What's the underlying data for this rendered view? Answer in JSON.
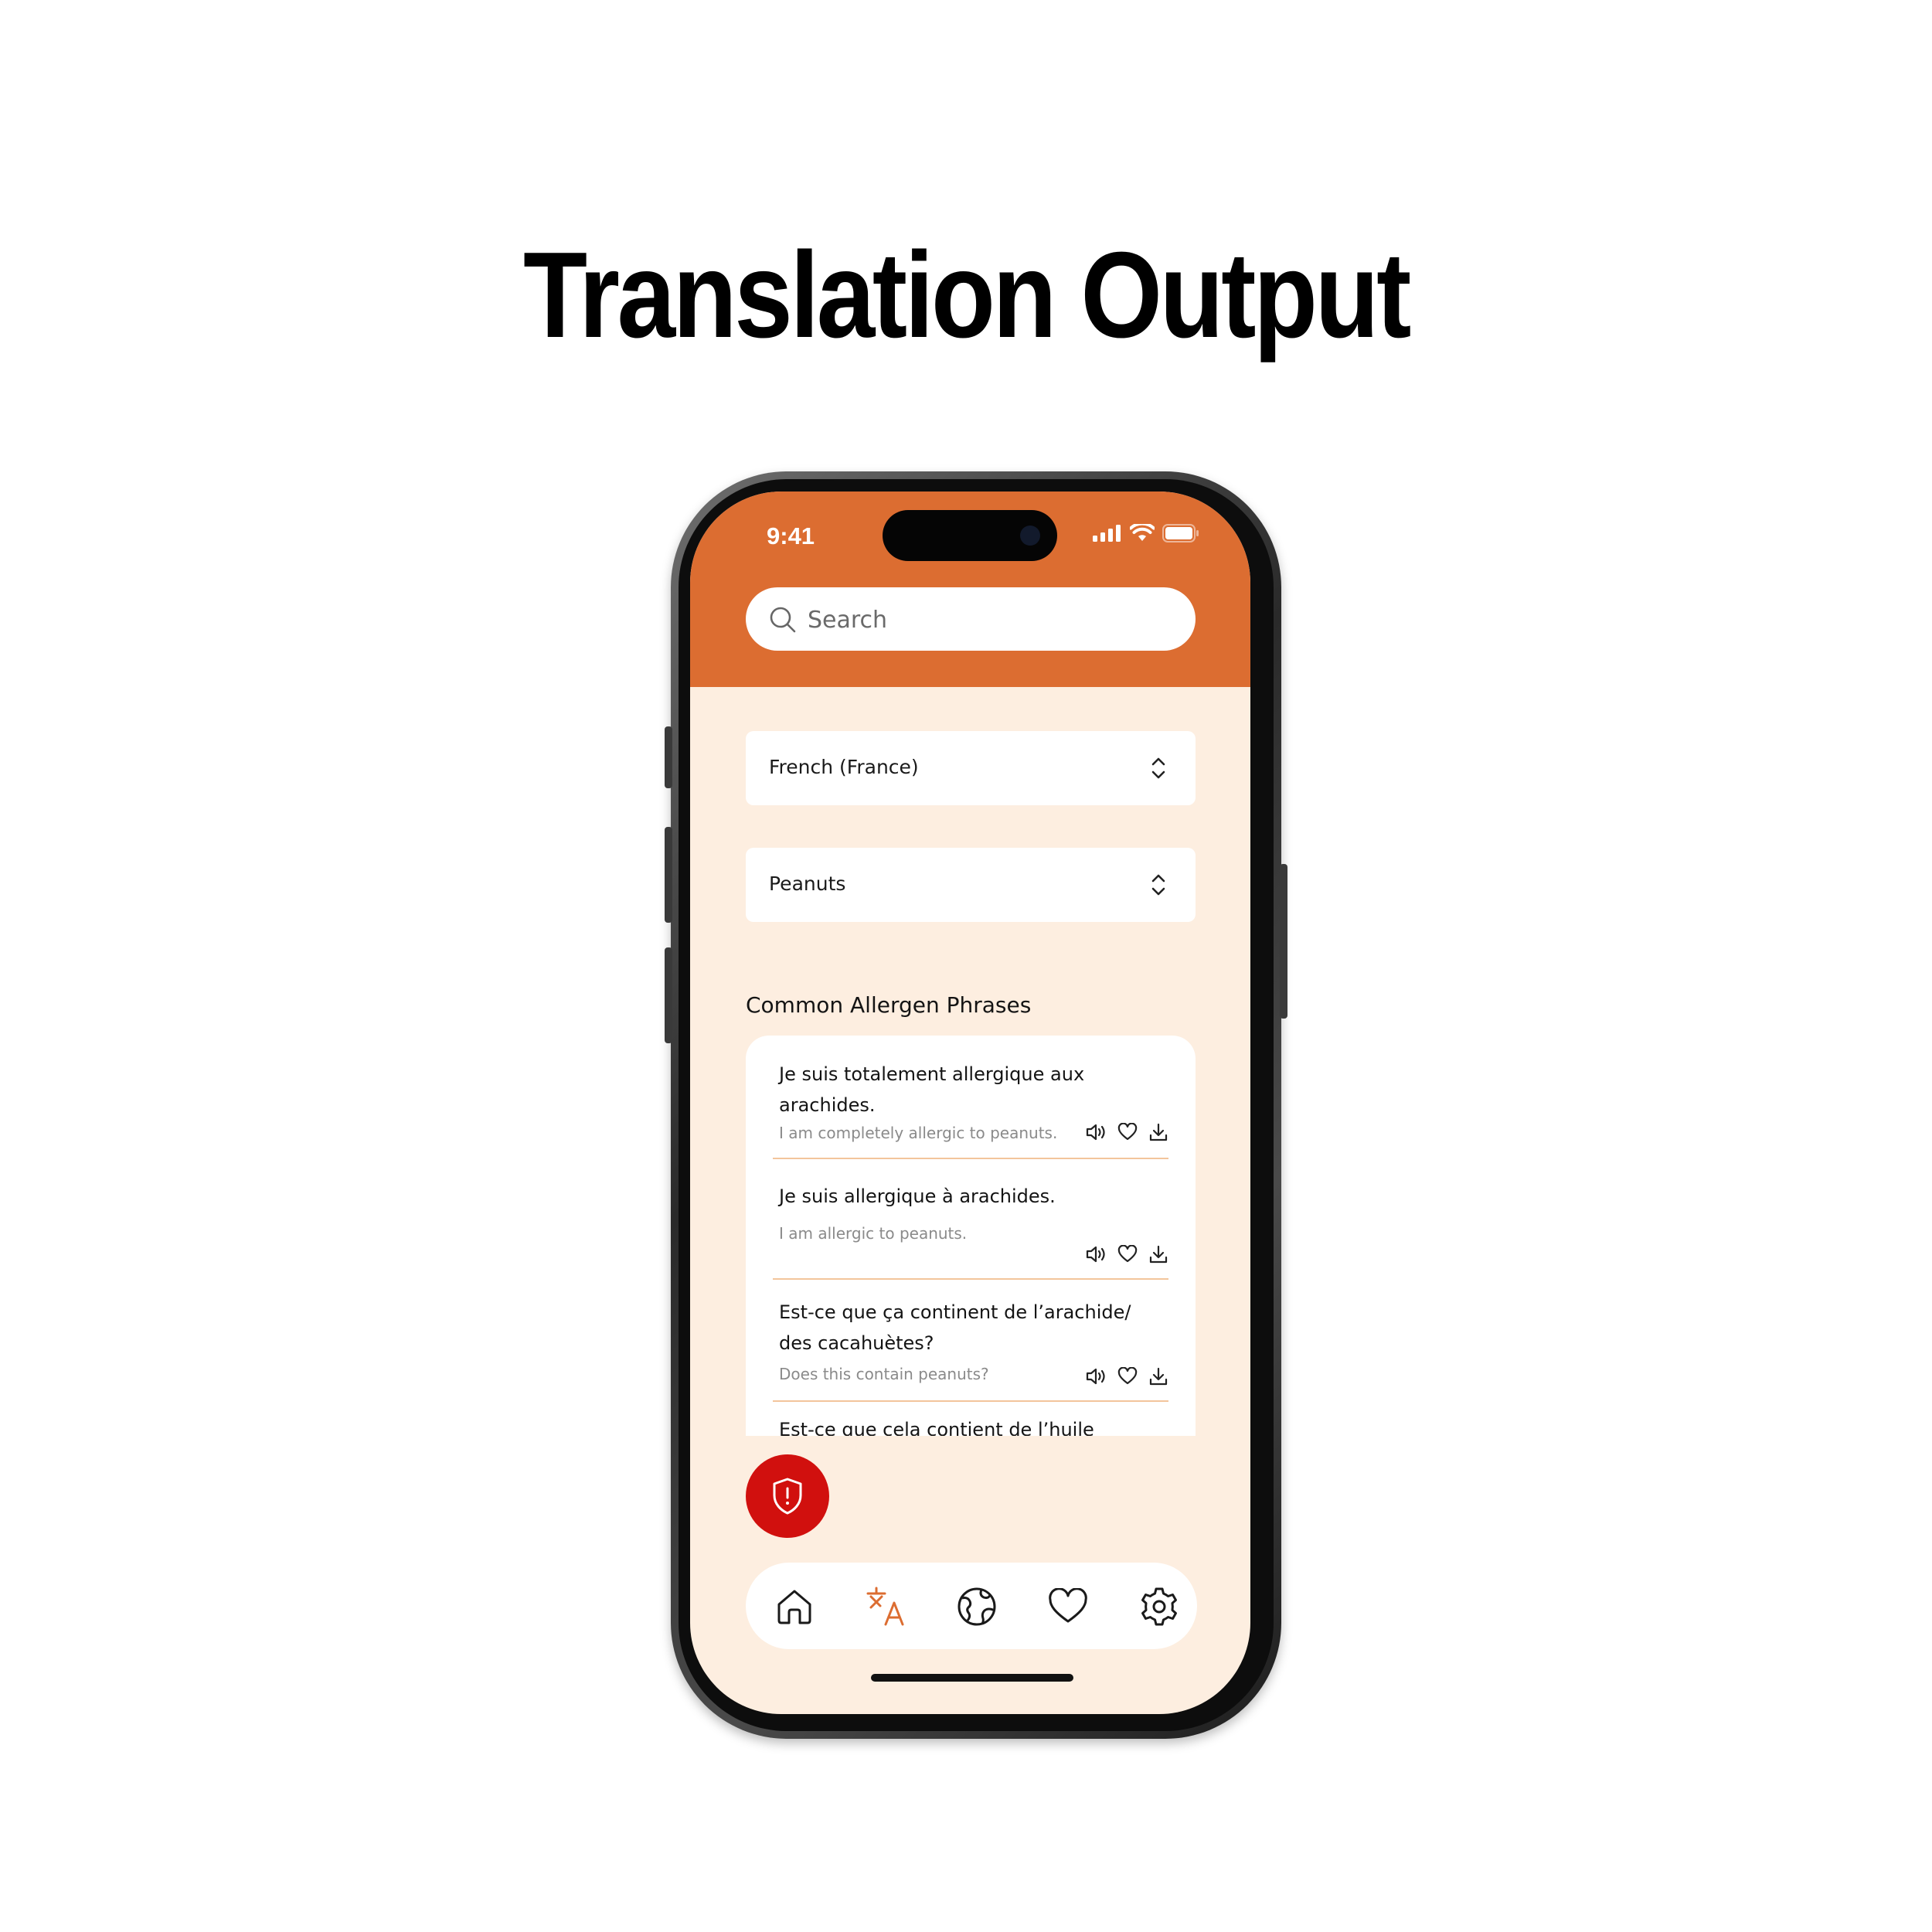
{
  "page": {
    "title": "Translation Output"
  },
  "status_bar": {
    "time": "9:41"
  },
  "search": {
    "placeholder": "Search"
  },
  "selects": {
    "language": "French (France)",
    "allergen": "Peanuts"
  },
  "phrases_section": {
    "title": "Common Allergen Phrases",
    "items": [
      {
        "french": "Je suis totalement allergique aux arachides.",
        "english": "I am completely allergic to peanuts."
      },
      {
        "french": "Je suis allergique à arachides.",
        "english": "I am allergic to peanuts."
      },
      {
        "french": "Est-ce que ça continent de l’arachide/ des cacahuètes?",
        "english": "Does this contain peanuts?"
      },
      {
        "french": "Est-ce que cela contient de l’huile",
        "english": ""
      }
    ]
  },
  "bottom_nav": {
    "items": [
      {
        "icon": "home-icon",
        "active": false
      },
      {
        "icon": "translate-icon",
        "active": true
      },
      {
        "icon": "globe-icon",
        "active": false
      },
      {
        "icon": "heart-icon",
        "active": false
      },
      {
        "icon": "gear-icon",
        "active": false
      }
    ]
  },
  "colors": {
    "accent": "#dc6d31",
    "background": "#fdeee0",
    "emergency": "#d1100e",
    "divider": "#f3c59c",
    "active_nav": "#dc6d31"
  }
}
